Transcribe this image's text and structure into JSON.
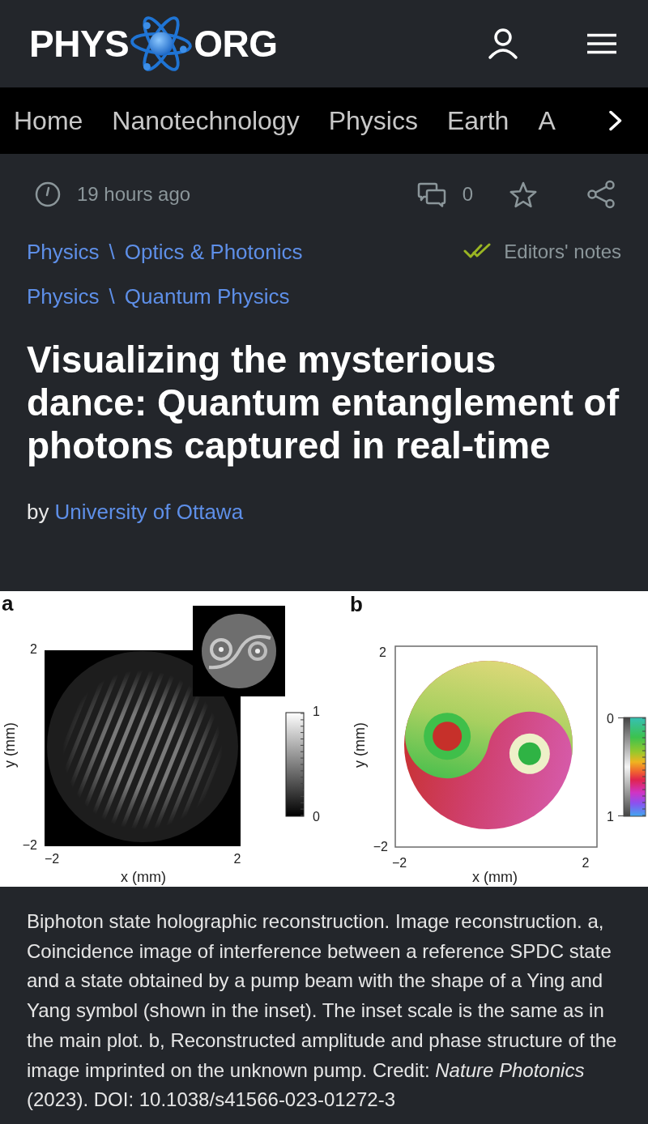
{
  "header": {
    "logo": {
      "left": "PHYS",
      "right": "ORG"
    }
  },
  "nav": {
    "items": [
      "Home",
      "Nanotechnology",
      "Physics",
      "Earth",
      "A"
    ]
  },
  "meta": {
    "time": "19 hours ago",
    "comments": "0"
  },
  "breadcrumbs": [
    {
      "items": [
        "Physics",
        "Optics & Photonics"
      ],
      "separator": "\\"
    },
    {
      "items": [
        "Physics",
        "Quantum Physics"
      ],
      "separator": "\\"
    }
  ],
  "editors_notes": "Editors' notes",
  "article": {
    "title": "Visualizing the mysterious dance: Quantum entanglement of photons captured in real-time",
    "byline_prefix": "by",
    "author": "University of Ottawa"
  },
  "figure": {
    "panels": [
      {
        "label": "a",
        "kind": "intensity",
        "inset": true,
        "yticks": [
          "2",
          "−2"
        ],
        "xticks": [
          "−2",
          "2"
        ],
        "xlabel": "x (mm)",
        "ylabel": "y (mm)",
        "colorbar_ticks": [
          "1",
          "0"
        ]
      },
      {
        "label": "b",
        "kind": "phase",
        "inset": false,
        "yticks": [
          "2",
          "−2"
        ],
        "xticks": [
          "−2",
          "2"
        ],
        "xlabel": "x (mm)",
        "ylabel": "y (mm)",
        "colorbar_ticks": [
          "0",
          "1"
        ]
      }
    ],
    "caption": "Biphoton state holographic reconstruction. Image reconstruction. a, Coincidence image of interference between a reference SPDC state and a state obtained by a pump beam with the shape of a Ying and Yang symbol (shown in the inset). The inset scale is the same as in the main plot. b, Reconstructed amplitude and phase structure of the image imprinted on the unknown pump. Credit: *Nature Photonics* (2023). DOI: 10.1038/s41566-023-01272-3"
  }
}
